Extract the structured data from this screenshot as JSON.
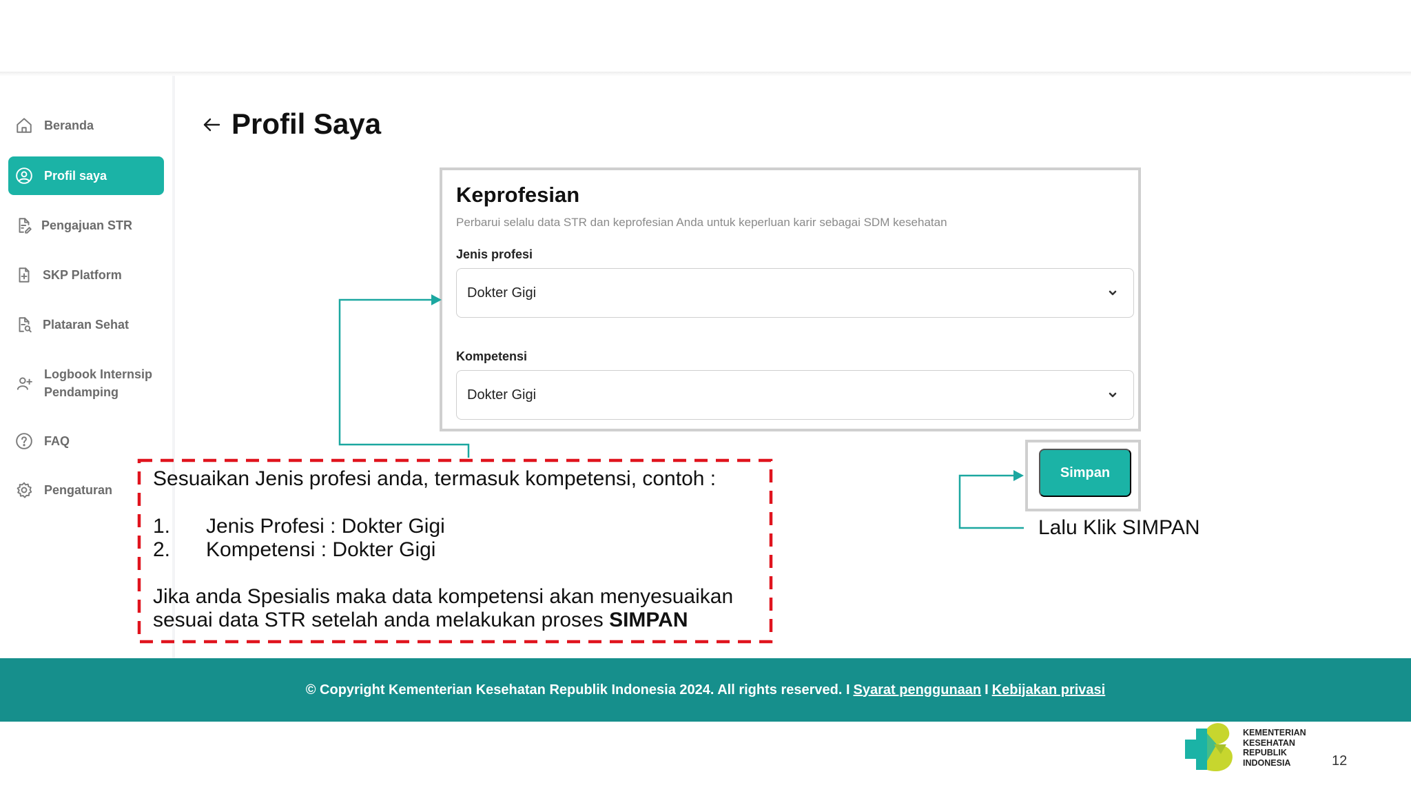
{
  "sidebar": {
    "items": [
      {
        "label": "Beranda",
        "icon": "home-icon"
      },
      {
        "label": "Profil saya",
        "icon": "user-circle-icon",
        "active": true
      },
      {
        "label": "Pengajuan STR",
        "icon": "document-edit-icon"
      },
      {
        "label": "SKP Platform",
        "icon": "document-add-icon"
      },
      {
        "label": "Plataran Sehat",
        "icon": "document-search-icon"
      },
      {
        "label_line1": "Logbook Internsip",
        "label_line2": "Pendamping",
        "icon": "user-add-icon"
      },
      {
        "label": "FAQ",
        "icon": "help-circle-icon"
      },
      {
        "label": "Pengaturan",
        "icon": "gear-icon"
      }
    ]
  },
  "page": {
    "title": "Profil Saya"
  },
  "card": {
    "title": "Keprofesian",
    "subtitle": "Perbarui selalu data STR dan keprofesian Anda untuk keperluan karir sebagai SDM kesehatan",
    "jenis_profesi": {
      "label": "Jenis profesi",
      "value": "Dokter Gigi"
    },
    "kompetensi": {
      "label": "Kompetensi",
      "value": "Dokter Gigi"
    }
  },
  "simpan_button": "Simpan",
  "annotation": {
    "intro": "Sesuaikan Jenis profesi anda, termasuk kompetensi, contoh :",
    "items": [
      {
        "num": "1.",
        "text": "Jenis Profesi : Dokter Gigi"
      },
      {
        "num": "2.",
        "text": "Kompetensi : Dokter Gigi"
      }
    ],
    "note_line1": "Jika anda Spesialis maka data kompetensi akan menyesuaikan",
    "note_line2_prefix": "sesuai data STR setelah anda melakukan proses ",
    "note_line2_bold": "SIMPAN",
    "simpan_hint": "Lalu Klik SIMPAN"
  },
  "footer": {
    "copyright": "© Copyright Kementerian Kesehatan Republik Indonesia 2024. All rights reserved. I",
    "link1": "Syarat penggunaan",
    "separator": "I",
    "link2": "Kebijakan privasi"
  },
  "logo": {
    "line1": "KEMENTERIAN",
    "line2": "KESEHATAN",
    "line3": "REPUBLIK",
    "line4": "INDONESIA"
  },
  "page_number": "12",
  "colors": {
    "accent": "#1bb3a6",
    "footer": "#168f8c",
    "annotation_border": "#e0141e"
  }
}
